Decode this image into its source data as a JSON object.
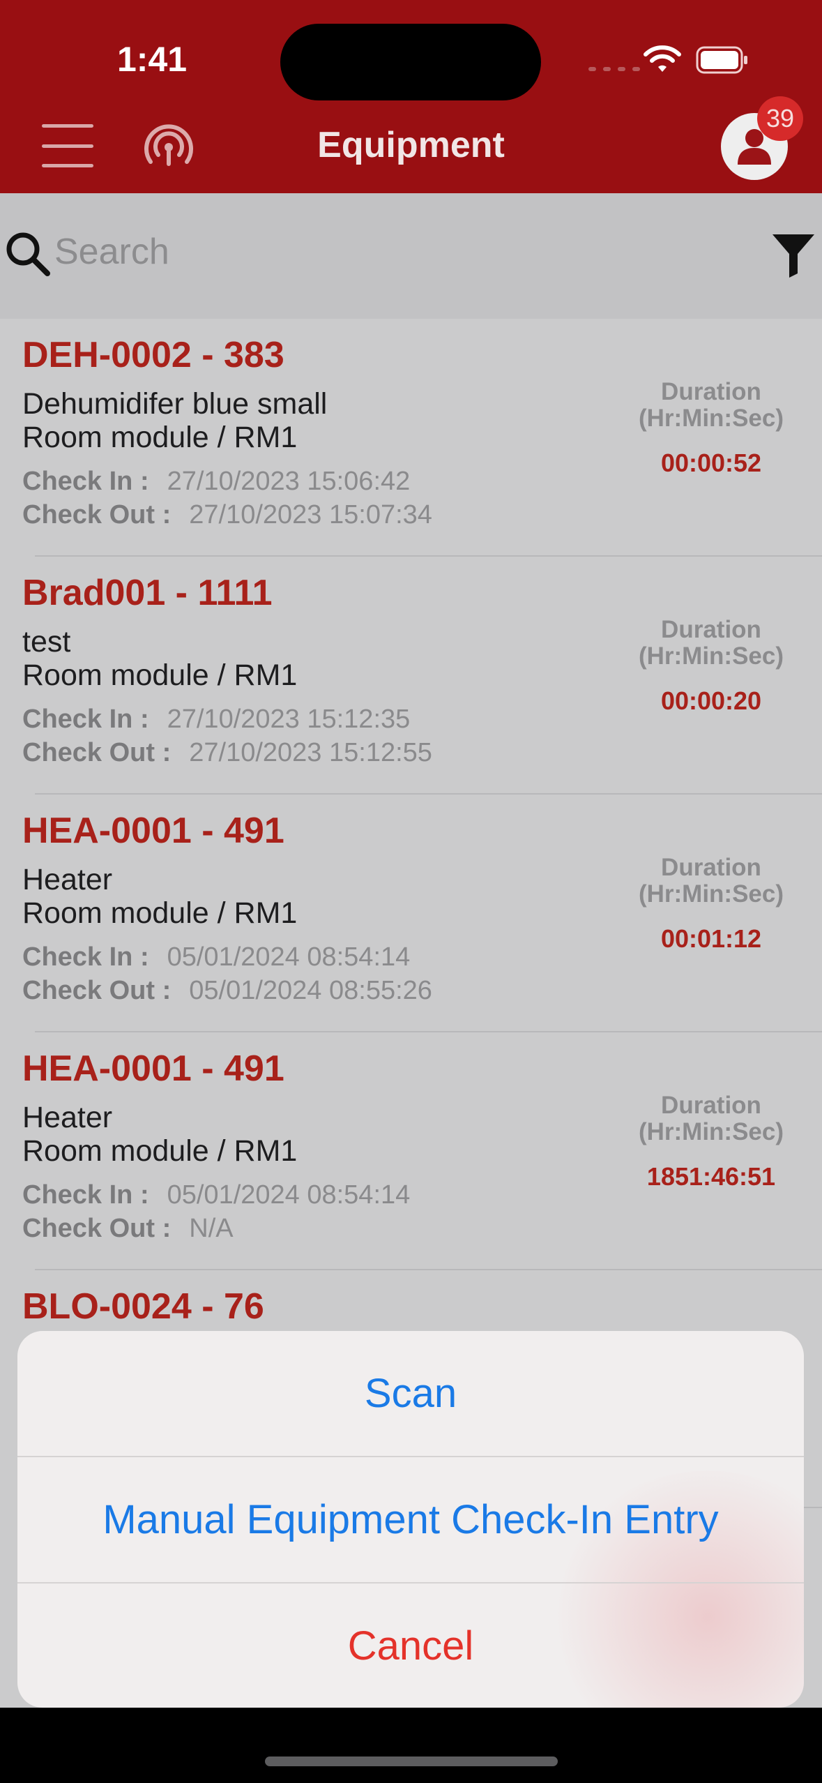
{
  "status_bar": {
    "time": "1:41"
  },
  "header": {
    "title": "Equipment",
    "notification_count": "39"
  },
  "search": {
    "placeholder": "Search"
  },
  "list": {
    "duration_label_line1": "Duration",
    "duration_label_line2": "(Hr:Min:Sec)",
    "check_in_label": "Check In :",
    "check_out_label": "Check Out :",
    "items": [
      {
        "title": "DEH-0002 - 383",
        "name": "Dehumidifer blue small",
        "location": "Room module  / RM1",
        "check_in": "27/10/2023 15:06:42",
        "check_out": "27/10/2023 15:07:34",
        "duration": "00:00:52"
      },
      {
        "title": "Brad001 - 1111",
        "name": "test",
        "location": "Room module  / RM1",
        "check_in": "27/10/2023 15:12:35",
        "check_out": "27/10/2023 15:12:55",
        "duration": "00:00:20"
      },
      {
        "title": "HEA-0001 - 491",
        "name": "Heater",
        "location": "Room module  / RM1",
        "check_in": "05/01/2024 08:54:14",
        "check_out": "05/01/2024 08:55:26",
        "duration": "00:01:12"
      },
      {
        "title": "HEA-0001 - 491",
        "name": "Heater",
        "location": "Room module  / RM1",
        "check_in": "05/01/2024 08:54:14",
        "check_out": "N/A",
        "duration": "1851:46:51"
      },
      {
        "title": "BLO-0024 - 76"
      }
    ]
  },
  "action_sheet": {
    "scan": "Scan",
    "manual_entry": "Manual Equipment Check-In Entry",
    "cancel": "Cancel"
  },
  "colors": {
    "header_bg": "#990f12",
    "accent_red": "#a8211a",
    "action_blue": "#1a7ae6",
    "cancel_red": "#e4322a"
  },
  "icons": [
    "hamburger-menu-icon",
    "broadcast-icon",
    "user-icon",
    "search-icon",
    "filter-icon",
    "wifi-icon",
    "battery-icon"
  ]
}
